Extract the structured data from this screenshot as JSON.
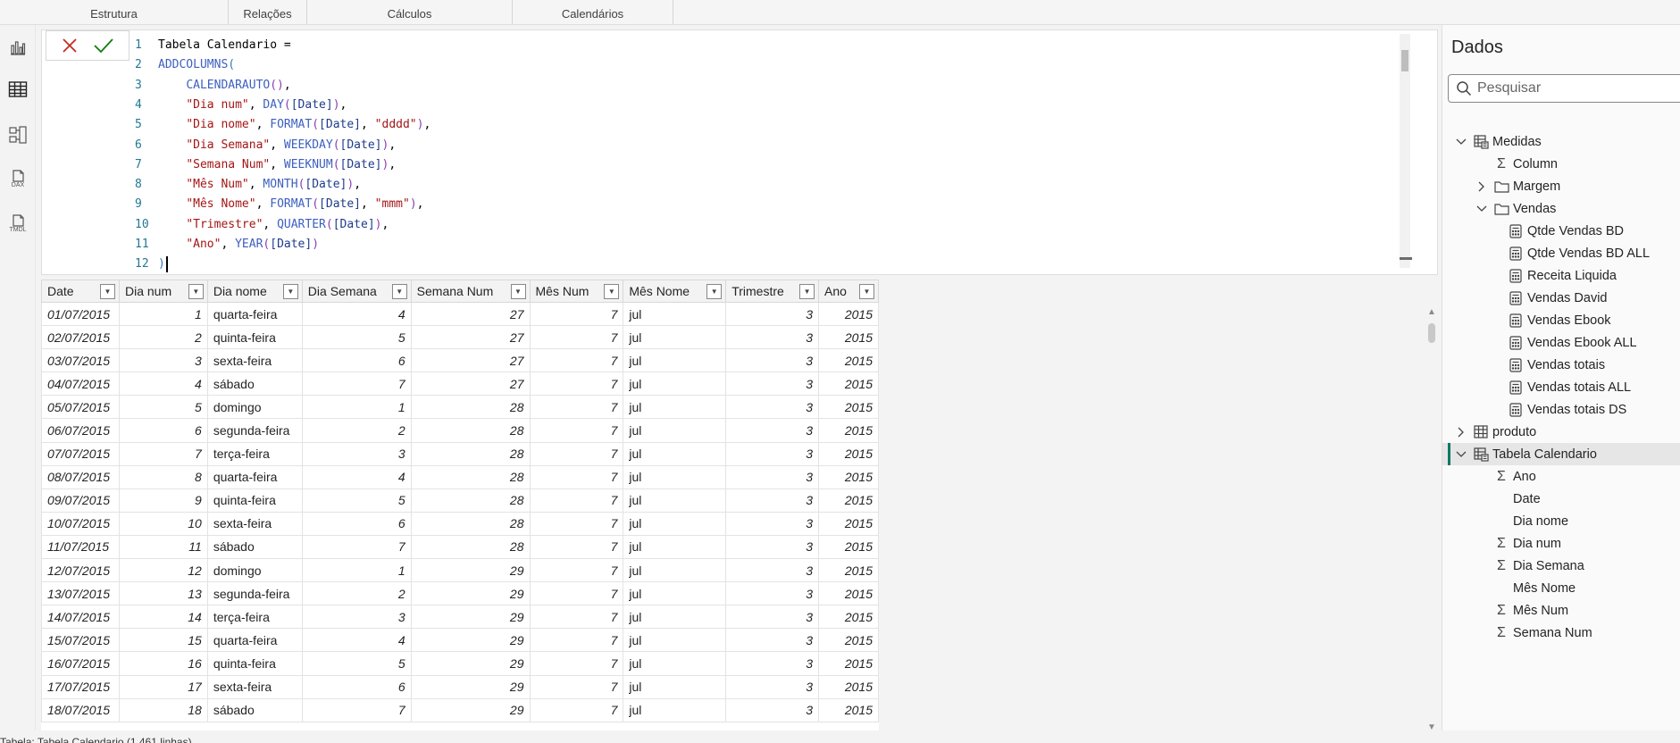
{
  "ribbon": {
    "groups": [
      "Estrutura",
      "Relações",
      "Cálculos",
      "Calendários"
    ]
  },
  "rail": {
    "icons": [
      "report-view-icon",
      "table-view-icon",
      "model-view-icon",
      "dax-query-view-icon",
      "tmdl-view-icon"
    ],
    "dax_label": "DAX",
    "tmdl_label": "TMDL"
  },
  "formula": {
    "lines": [
      {
        "n": "1",
        "tokens": [
          {
            "t": "Tabela Calendario =",
            "c": "plain"
          }
        ]
      },
      {
        "n": "2",
        "tokens": [
          {
            "t": "ADDCOLUMNS",
            "c": "func"
          },
          {
            "t": "(",
            "c": "br1"
          }
        ]
      },
      {
        "n": "3",
        "tokens": [
          {
            "t": "    ",
            "c": "plain"
          },
          {
            "t": "CALENDARAUTO",
            "c": "func"
          },
          {
            "t": "()",
            "c": "br2"
          },
          {
            "t": ",",
            "c": "plain"
          }
        ]
      },
      {
        "n": "4",
        "tokens": [
          {
            "t": "    ",
            "c": "plain"
          },
          {
            "t": "\"Dia num\"",
            "c": "str"
          },
          {
            "t": ", ",
            "c": "plain"
          },
          {
            "t": "DAY",
            "c": "func"
          },
          {
            "t": "(",
            "c": "br2"
          },
          {
            "t": "[Date]",
            "c": "col"
          },
          {
            "t": ")",
            "c": "br2"
          },
          {
            "t": ",",
            "c": "plain"
          }
        ]
      },
      {
        "n": "5",
        "tokens": [
          {
            "t": "    ",
            "c": "plain"
          },
          {
            "t": "\"Dia nome\"",
            "c": "str"
          },
          {
            "t": ", ",
            "c": "plain"
          },
          {
            "t": "FORMAT",
            "c": "func"
          },
          {
            "t": "(",
            "c": "br2"
          },
          {
            "t": "[Date]",
            "c": "col"
          },
          {
            "t": ", ",
            "c": "plain"
          },
          {
            "t": "\"dddd\"",
            "c": "str"
          },
          {
            "t": ")",
            "c": "br2"
          },
          {
            "t": ",",
            "c": "plain"
          }
        ]
      },
      {
        "n": "6",
        "tokens": [
          {
            "t": "    ",
            "c": "plain"
          },
          {
            "t": "\"Dia Semana\"",
            "c": "str"
          },
          {
            "t": ", ",
            "c": "plain"
          },
          {
            "t": "WEEKDAY",
            "c": "func"
          },
          {
            "t": "(",
            "c": "br2"
          },
          {
            "t": "[Date]",
            "c": "col"
          },
          {
            "t": ")",
            "c": "br2"
          },
          {
            "t": ",",
            "c": "plain"
          }
        ]
      },
      {
        "n": "7",
        "tokens": [
          {
            "t": "    ",
            "c": "plain"
          },
          {
            "t": "\"Semana Num\"",
            "c": "str"
          },
          {
            "t": ", ",
            "c": "plain"
          },
          {
            "t": "WEEKNUM",
            "c": "func"
          },
          {
            "t": "(",
            "c": "br2"
          },
          {
            "t": "[Date]",
            "c": "col"
          },
          {
            "t": ")",
            "c": "br2"
          },
          {
            "t": ",",
            "c": "plain"
          }
        ]
      },
      {
        "n": "8",
        "tokens": [
          {
            "t": "    ",
            "c": "plain"
          },
          {
            "t": "\"Mês Num\"",
            "c": "str"
          },
          {
            "t": ", ",
            "c": "plain"
          },
          {
            "t": "MONTH",
            "c": "func"
          },
          {
            "t": "(",
            "c": "br2"
          },
          {
            "t": "[Date]",
            "c": "col"
          },
          {
            "t": ")",
            "c": "br2"
          },
          {
            "t": ",",
            "c": "plain"
          }
        ]
      },
      {
        "n": "9",
        "tokens": [
          {
            "t": "    ",
            "c": "plain"
          },
          {
            "t": "\"Mês Nome\"",
            "c": "str"
          },
          {
            "t": ", ",
            "c": "plain"
          },
          {
            "t": "FORMAT",
            "c": "func"
          },
          {
            "t": "(",
            "c": "br2"
          },
          {
            "t": "[Date]",
            "c": "col"
          },
          {
            "t": ", ",
            "c": "plain"
          },
          {
            "t": "\"mmm\"",
            "c": "str"
          },
          {
            "t": ")",
            "c": "br2"
          },
          {
            "t": ",",
            "c": "plain"
          }
        ]
      },
      {
        "n": "10",
        "tokens": [
          {
            "t": "    ",
            "c": "plain"
          },
          {
            "t": "\"Trimestre\"",
            "c": "str"
          },
          {
            "t": ", ",
            "c": "plain"
          },
          {
            "t": "QUARTER",
            "c": "func"
          },
          {
            "t": "(",
            "c": "br2"
          },
          {
            "t": "[Date]",
            "c": "col"
          },
          {
            "t": ")",
            "c": "br2"
          },
          {
            "t": ",",
            "c": "plain"
          }
        ]
      },
      {
        "n": "11",
        "tokens": [
          {
            "t": "    ",
            "c": "plain"
          },
          {
            "t": "\"Ano\"",
            "c": "str"
          },
          {
            "t": ", ",
            "c": "plain"
          },
          {
            "t": "YEAR",
            "c": "func"
          },
          {
            "t": "(",
            "c": "br2"
          },
          {
            "t": "[Date]",
            "c": "col"
          },
          {
            "t": ")",
            "c": "br2"
          }
        ]
      },
      {
        "n": "12",
        "tokens": [
          {
            "t": ")",
            "c": "br1"
          }
        ]
      }
    ]
  },
  "grid": {
    "columns": [
      "Date",
      "Dia num",
      "Dia nome",
      "Dia Semana",
      "Semana Num",
      "Mês Num",
      "Mês Nome",
      "Trimestre",
      "Ano"
    ],
    "rows": [
      [
        "01/07/2015",
        "1",
        "quarta-feira",
        "4",
        "27",
        "7",
        "jul",
        "3",
        "2015"
      ],
      [
        "02/07/2015",
        "2",
        "quinta-feira",
        "5",
        "27",
        "7",
        "jul",
        "3",
        "2015"
      ],
      [
        "03/07/2015",
        "3",
        "sexta-feira",
        "6",
        "27",
        "7",
        "jul",
        "3",
        "2015"
      ],
      [
        "04/07/2015",
        "4",
        "sábado",
        "7",
        "27",
        "7",
        "jul",
        "3",
        "2015"
      ],
      [
        "05/07/2015",
        "5",
        "domingo",
        "1",
        "28",
        "7",
        "jul",
        "3",
        "2015"
      ],
      [
        "06/07/2015",
        "6",
        "segunda-feira",
        "2",
        "28",
        "7",
        "jul",
        "3",
        "2015"
      ],
      [
        "07/07/2015",
        "7",
        "terça-feira",
        "3",
        "28",
        "7",
        "jul",
        "3",
        "2015"
      ],
      [
        "08/07/2015",
        "8",
        "quarta-feira",
        "4",
        "28",
        "7",
        "jul",
        "3",
        "2015"
      ],
      [
        "09/07/2015",
        "9",
        "quinta-feira",
        "5",
        "28",
        "7",
        "jul",
        "3",
        "2015"
      ],
      [
        "10/07/2015",
        "10",
        "sexta-feira",
        "6",
        "28",
        "7",
        "jul",
        "3",
        "2015"
      ],
      [
        "11/07/2015",
        "11",
        "sábado",
        "7",
        "28",
        "7",
        "jul",
        "3",
        "2015"
      ],
      [
        "12/07/2015",
        "12",
        "domingo",
        "1",
        "29",
        "7",
        "jul",
        "3",
        "2015"
      ],
      [
        "13/07/2015",
        "13",
        "segunda-feira",
        "2",
        "29",
        "7",
        "jul",
        "3",
        "2015"
      ],
      [
        "14/07/2015",
        "14",
        "terça-feira",
        "3",
        "29",
        "7",
        "jul",
        "3",
        "2015"
      ],
      [
        "15/07/2015",
        "15",
        "quarta-feira",
        "4",
        "29",
        "7",
        "jul",
        "3",
        "2015"
      ],
      [
        "16/07/2015",
        "16",
        "quinta-feira",
        "5",
        "29",
        "7",
        "jul",
        "3",
        "2015"
      ],
      [
        "17/07/2015",
        "17",
        "sexta-feira",
        "6",
        "29",
        "7",
        "jul",
        "3",
        "2015"
      ],
      [
        "18/07/2015",
        "18",
        "sábado",
        "7",
        "29",
        "7",
        "jul",
        "3",
        "2015"
      ]
    ]
  },
  "status": {
    "text": "Tabela: Tabela Calendario (1.461 linhas)"
  },
  "data_pane": {
    "title": "Dados",
    "search_placeholder": "Pesquisar",
    "tree": [
      {
        "label": "Medidas",
        "level": 0,
        "twisty": "expanded",
        "icon": "measure-table-icon"
      },
      {
        "label": "Column",
        "level": 1,
        "twisty": "none",
        "icon": "sigma-icon"
      },
      {
        "label": "Margem",
        "level": 1,
        "twisty": "collapsed",
        "icon": "folder-icon"
      },
      {
        "label": "Vendas",
        "level": 1,
        "twisty": "expanded",
        "icon": "folder-icon"
      },
      {
        "label": "Qtde Vendas BD",
        "level": 2,
        "twisty": "none",
        "icon": "calculator-icon"
      },
      {
        "label": "Qtde Vendas BD ALL",
        "level": 2,
        "twisty": "none",
        "icon": "calculator-icon"
      },
      {
        "label": "Receita Liquida",
        "level": 2,
        "twisty": "none",
        "icon": "calculator-icon"
      },
      {
        "label": "Vendas David",
        "level": 2,
        "twisty": "none",
        "icon": "calculator-icon"
      },
      {
        "label": "Vendas Ebook",
        "level": 2,
        "twisty": "none",
        "icon": "calculator-icon"
      },
      {
        "label": "Vendas Ebook ALL",
        "level": 2,
        "twisty": "none",
        "icon": "calculator-icon"
      },
      {
        "label": "Vendas totais",
        "level": 2,
        "twisty": "none",
        "icon": "calculator-icon"
      },
      {
        "label": "Vendas totais ALL",
        "level": 2,
        "twisty": "none",
        "icon": "calculator-icon"
      },
      {
        "label": "Vendas totais DS",
        "level": 2,
        "twisty": "none",
        "icon": "calculator-icon"
      },
      {
        "label": "produto",
        "level": 0,
        "twisty": "collapsed",
        "icon": "table-icon"
      },
      {
        "label": "Tabela Calendario",
        "level": 0,
        "twisty": "expanded",
        "icon": "calc-table-icon",
        "selected": true
      },
      {
        "label": "Ano",
        "level": 1,
        "twisty": "none",
        "icon": "sigma-icon"
      },
      {
        "label": "Date",
        "level": 1,
        "twisty": "none",
        "icon": "none"
      },
      {
        "label": "Dia nome",
        "level": 1,
        "twisty": "none",
        "icon": "none"
      },
      {
        "label": "Dia num",
        "level": 1,
        "twisty": "none",
        "icon": "sigma-icon"
      },
      {
        "label": "Dia Semana",
        "level": 1,
        "twisty": "none",
        "icon": "sigma-icon"
      },
      {
        "label": "Mês Nome",
        "level": 1,
        "twisty": "none",
        "icon": "none"
      },
      {
        "label": "Mês Num",
        "level": 1,
        "twisty": "none",
        "icon": "sigma-icon"
      },
      {
        "label": "Semana Num",
        "level": 1,
        "twisty": "none",
        "icon": "sigma-icon"
      }
    ]
  },
  "colors": {
    "cancel": "#c42b1c",
    "commit": "#107c10",
    "selection_accent": "#117865"
  }
}
